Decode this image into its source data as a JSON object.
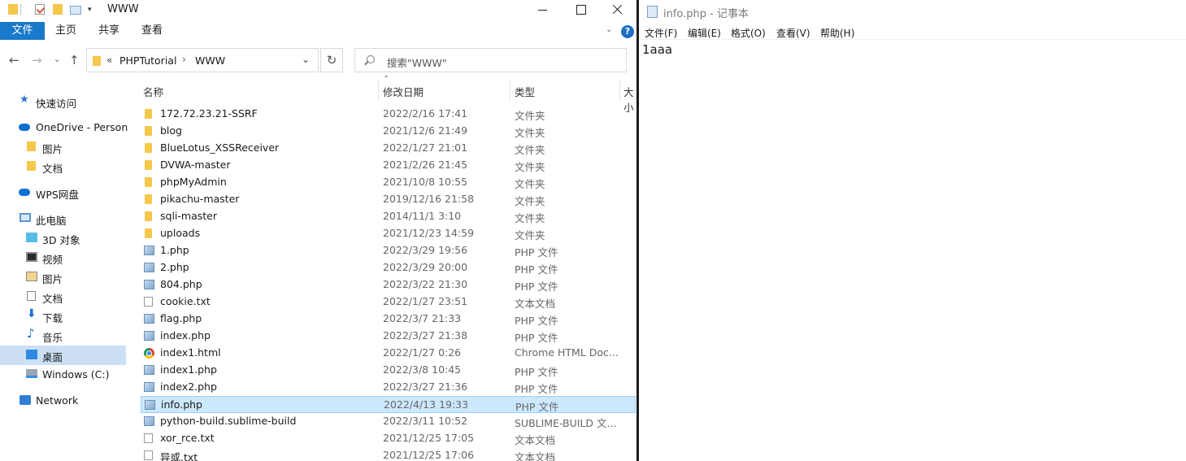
{
  "explorer": {
    "title": "WWW",
    "ribbon": {
      "file": "文件",
      "tabs": [
        "主页",
        "共享",
        "查看"
      ]
    },
    "address": {
      "overflow": "«",
      "segments": [
        "PHPTutorial",
        "WWW"
      ]
    },
    "search": {
      "placeholder": "搜索\"WWW\""
    },
    "columns": [
      "名称",
      "修改日期",
      "类型",
      "大小"
    ],
    "sidebar": [
      {
        "label": "快速访问",
        "icon": "star-icon"
      },
      {
        "label": "OneDrive - Personal",
        "icon": "cloud-icon"
      },
      {
        "label": "图片",
        "icon": "folder-icon"
      },
      {
        "label": "文档",
        "icon": "folder-icon"
      },
      {
        "label": "WPS网盘",
        "icon": "cloud-icon"
      },
      {
        "label": "此电脑",
        "icon": "computer-icon"
      },
      {
        "label": "3D 对象",
        "icon": "3d-objects-icon"
      },
      {
        "label": "视频",
        "icon": "video-icon"
      },
      {
        "label": "图片",
        "icon": "pictures-icon"
      },
      {
        "label": "文档",
        "icon": "documents-icon"
      },
      {
        "label": "下载",
        "icon": "download-icon"
      },
      {
        "label": "音乐",
        "icon": "music-icon"
      },
      {
        "label": "桌面",
        "icon": "desktop-icon"
      },
      {
        "label": "Windows (C:)",
        "icon": "drive-icon"
      },
      {
        "label": "Network",
        "icon": "network-icon"
      }
    ],
    "files": [
      {
        "name": "172.72.23.21-SSRF",
        "date": "2022/2/16 17:41",
        "type": "文件夹",
        "icon": "folder"
      },
      {
        "name": "blog",
        "date": "2021/12/6 21:49",
        "type": "文件夹",
        "icon": "folder"
      },
      {
        "name": "BlueLotus_XSSReceiver",
        "date": "2022/1/27 21:01",
        "type": "文件夹",
        "icon": "folder"
      },
      {
        "name": "DVWA-master",
        "date": "2021/2/26 21:45",
        "type": "文件夹",
        "icon": "folder"
      },
      {
        "name": "phpMyAdmin",
        "date": "2021/10/8 10:55",
        "type": "文件夹",
        "icon": "folder"
      },
      {
        "name": "pikachu-master",
        "date": "2019/12/16 21:58",
        "type": "文件夹",
        "icon": "folder"
      },
      {
        "name": "sqli-master",
        "date": "2014/11/1 3:10",
        "type": "文件夹",
        "icon": "folder"
      },
      {
        "name": "uploads",
        "date": "2021/12/23 14:59",
        "type": "文件夹",
        "icon": "folder"
      },
      {
        "name": "1.php",
        "date": "2022/3/29 19:56",
        "type": "PHP 文件",
        "icon": "php"
      },
      {
        "name": "2.php",
        "date": "2022/3/29 20:00",
        "type": "PHP 文件",
        "icon": "php"
      },
      {
        "name": "804.php",
        "date": "2022/3/22 21:30",
        "type": "PHP 文件",
        "icon": "php"
      },
      {
        "name": "cookie.txt",
        "date": "2022/1/27 23:51",
        "type": "文本文档",
        "icon": "txt"
      },
      {
        "name": "flag.php",
        "date": "2022/3/7 21:33",
        "type": "PHP 文件",
        "icon": "php"
      },
      {
        "name": "index.php",
        "date": "2022/3/27 21:38",
        "type": "PHP 文件",
        "icon": "php"
      },
      {
        "name": "index1.html",
        "date": "2022/1/27 0:26",
        "type": "Chrome HTML Doc...",
        "icon": "chrome"
      },
      {
        "name": "index1.php",
        "date": "2022/3/8 10:45",
        "type": "PHP 文件",
        "icon": "php"
      },
      {
        "name": "index2.php",
        "date": "2022/3/27 21:36",
        "type": "PHP 文件",
        "icon": "php"
      },
      {
        "name": "info.php",
        "date": "2022/4/13 19:33",
        "type": "PHP 文件",
        "icon": "php",
        "selected": true
      },
      {
        "name": "python-build.sublime-build",
        "date": "2022/3/11 10:52",
        "type": "SUBLIME-BUILD 文...",
        "icon": "php"
      },
      {
        "name": "xor_rce.txt",
        "date": "2021/12/25 17:05",
        "type": "文本文档",
        "icon": "txt"
      },
      {
        "name": "异或.txt",
        "date": "2021/12/25 17:06",
        "type": "文本文档",
        "icon": "txt"
      }
    ]
  },
  "notepad": {
    "title": "info.php - 记事本",
    "menu": [
      "文件(F)",
      "编辑(E)",
      "格式(O)",
      "查看(V)",
      "帮助(H)"
    ],
    "content": "1aaa"
  }
}
